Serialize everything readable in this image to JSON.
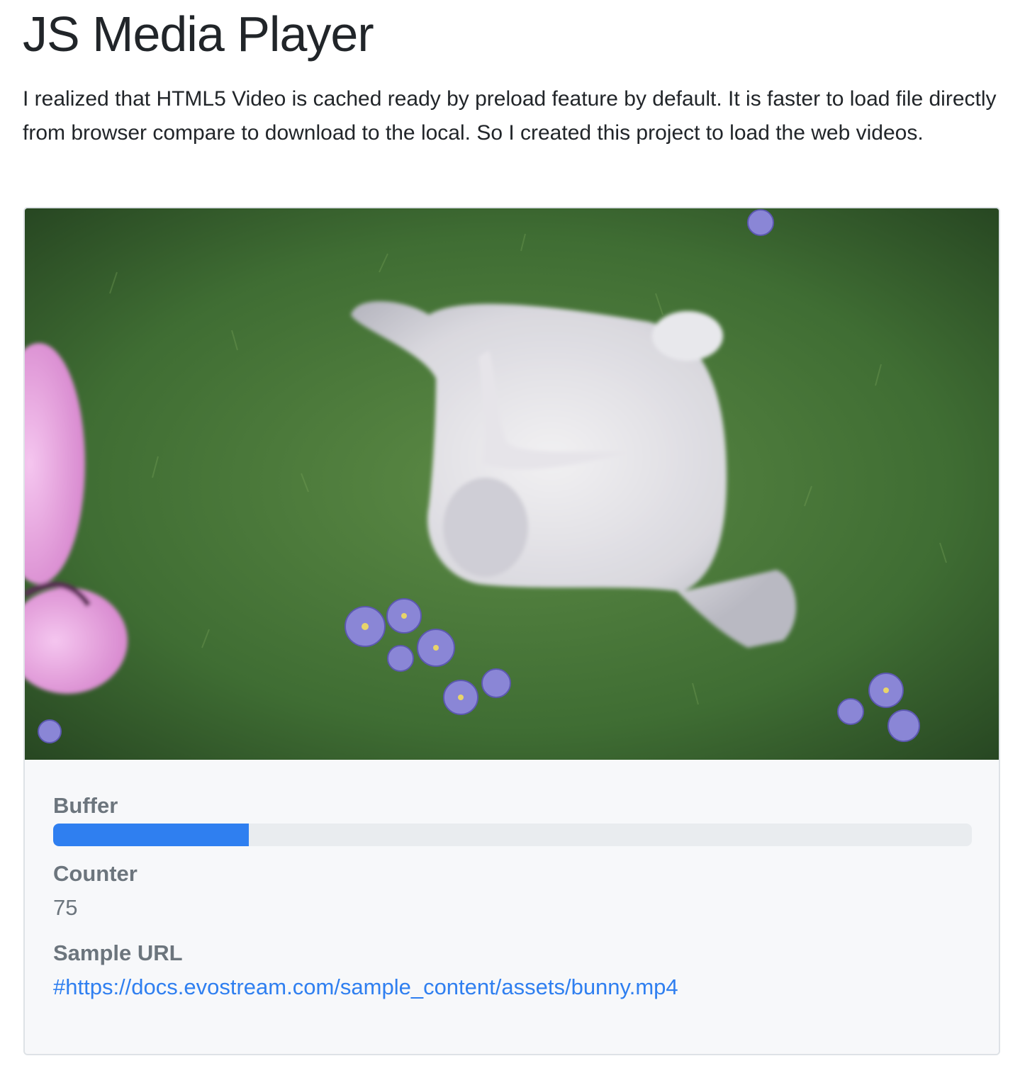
{
  "header": {
    "title": "JS Media Player",
    "description": "I realized that HTML5 Video is cached ready by preload feature by default. It is faster to load file directly from browser compare to download to the local. So I created this project to load the web videos."
  },
  "player": {
    "buffer_label": "Buffer",
    "buffer_percent": 21.3,
    "counter_label": "Counter",
    "counter_value": "75",
    "sample_url_label": "Sample URL",
    "sample_url": "#https://docs.evostream.com/sample_content/assets/bunny.mp4"
  },
  "colors": {
    "accent": "#2f7ff0",
    "muted_text": "#6c757d",
    "panel_bg": "#f7f8fa",
    "track_bg": "#e9ecef"
  }
}
